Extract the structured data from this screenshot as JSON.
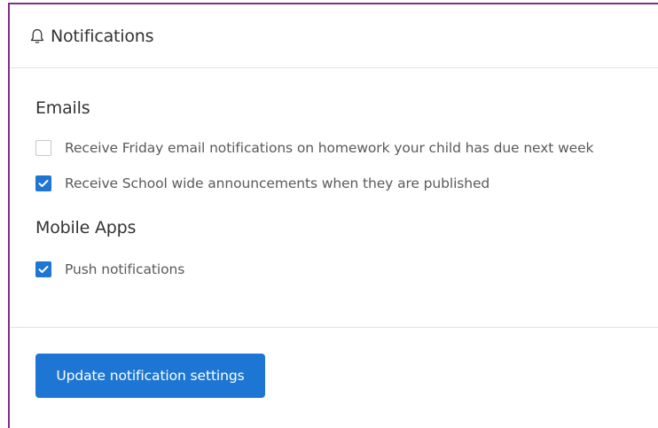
{
  "header": {
    "icon": "bell-icon",
    "title": "Notifications"
  },
  "emails": {
    "heading": "Emails",
    "options": [
      {
        "label": "Receive Friday email notifications on homework your child has due next week",
        "checked": false
      },
      {
        "label": "Receive School wide announcements when they are published",
        "checked": true
      }
    ]
  },
  "mobile_apps": {
    "heading": "Mobile Apps",
    "options": [
      {
        "label": "Push notifications",
        "checked": true
      }
    ]
  },
  "footer": {
    "submit_label": "Update notification settings"
  },
  "colors": {
    "accent": "#1d76d3",
    "panel_border": "#7e2f86"
  }
}
